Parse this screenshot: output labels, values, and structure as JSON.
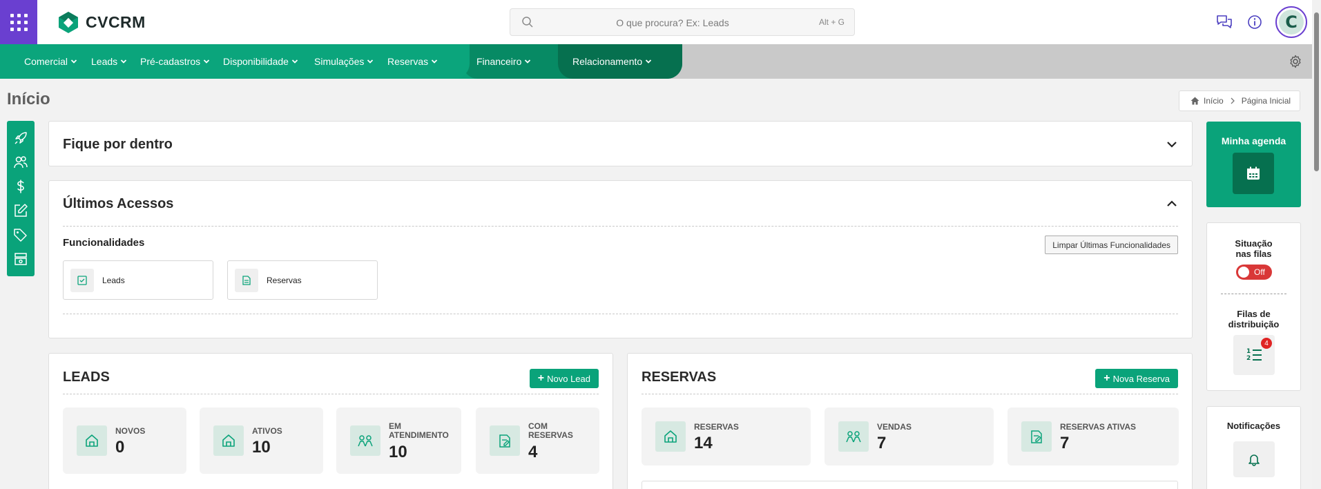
{
  "header": {
    "logo_text": "CVCRM",
    "search_placeholder": "O que procura? Ex: Leads",
    "search_shortcut": "Alt + G",
    "avatar_initial": "C"
  },
  "nav": {
    "items": [
      {
        "label": "Comercial"
      },
      {
        "label": "Leads"
      },
      {
        "label": "Pré-cadastros"
      },
      {
        "label": "Disponibilidade"
      },
      {
        "label": "Simulações"
      },
      {
        "label": "Reservas"
      },
      {
        "label": "Financeiro"
      },
      {
        "label": "Relacionamento"
      }
    ]
  },
  "page": {
    "title": "Início",
    "breadcrumb": [
      "Início",
      "Página Inicial"
    ]
  },
  "fique": {
    "title": "Fique por dentro"
  },
  "ultimos": {
    "title": "Últimos Acessos",
    "subtitle": "Funcionalidades",
    "clear_label": "Limpar Últimas Funcionalidades",
    "tiles": [
      {
        "label": "Leads"
      },
      {
        "label": "Reservas"
      }
    ]
  },
  "leads": {
    "title": "LEADS",
    "button": "Novo Lead",
    "stats": [
      {
        "label": "Novos",
        "value": "0"
      },
      {
        "label": "Ativos",
        "value": "10"
      },
      {
        "label": "Em atendimento",
        "value": "10"
      },
      {
        "label": "Com reservas",
        "value": "4"
      }
    ]
  },
  "reservas": {
    "title": "RESERVAS",
    "button": "Nova Reserva",
    "stats": [
      {
        "label": "Reservas",
        "value": "14"
      },
      {
        "label": "Vendas",
        "value": "7"
      },
      {
        "label": "Reservas ativas",
        "value": "7"
      }
    ]
  },
  "sidebar": {
    "agenda_title": "Minha agenda",
    "situacao_title": "Situação nas filas",
    "toggle_label": "Off",
    "filas_title": "Filas de distribuição",
    "filas_badge": "4",
    "notificacoes_title": "Notificações"
  },
  "colors": {
    "primary": "#0aa37a",
    "dark_green": "#06704f",
    "apps_purple": "#6a3fd0",
    "off_red": "#d93838"
  }
}
